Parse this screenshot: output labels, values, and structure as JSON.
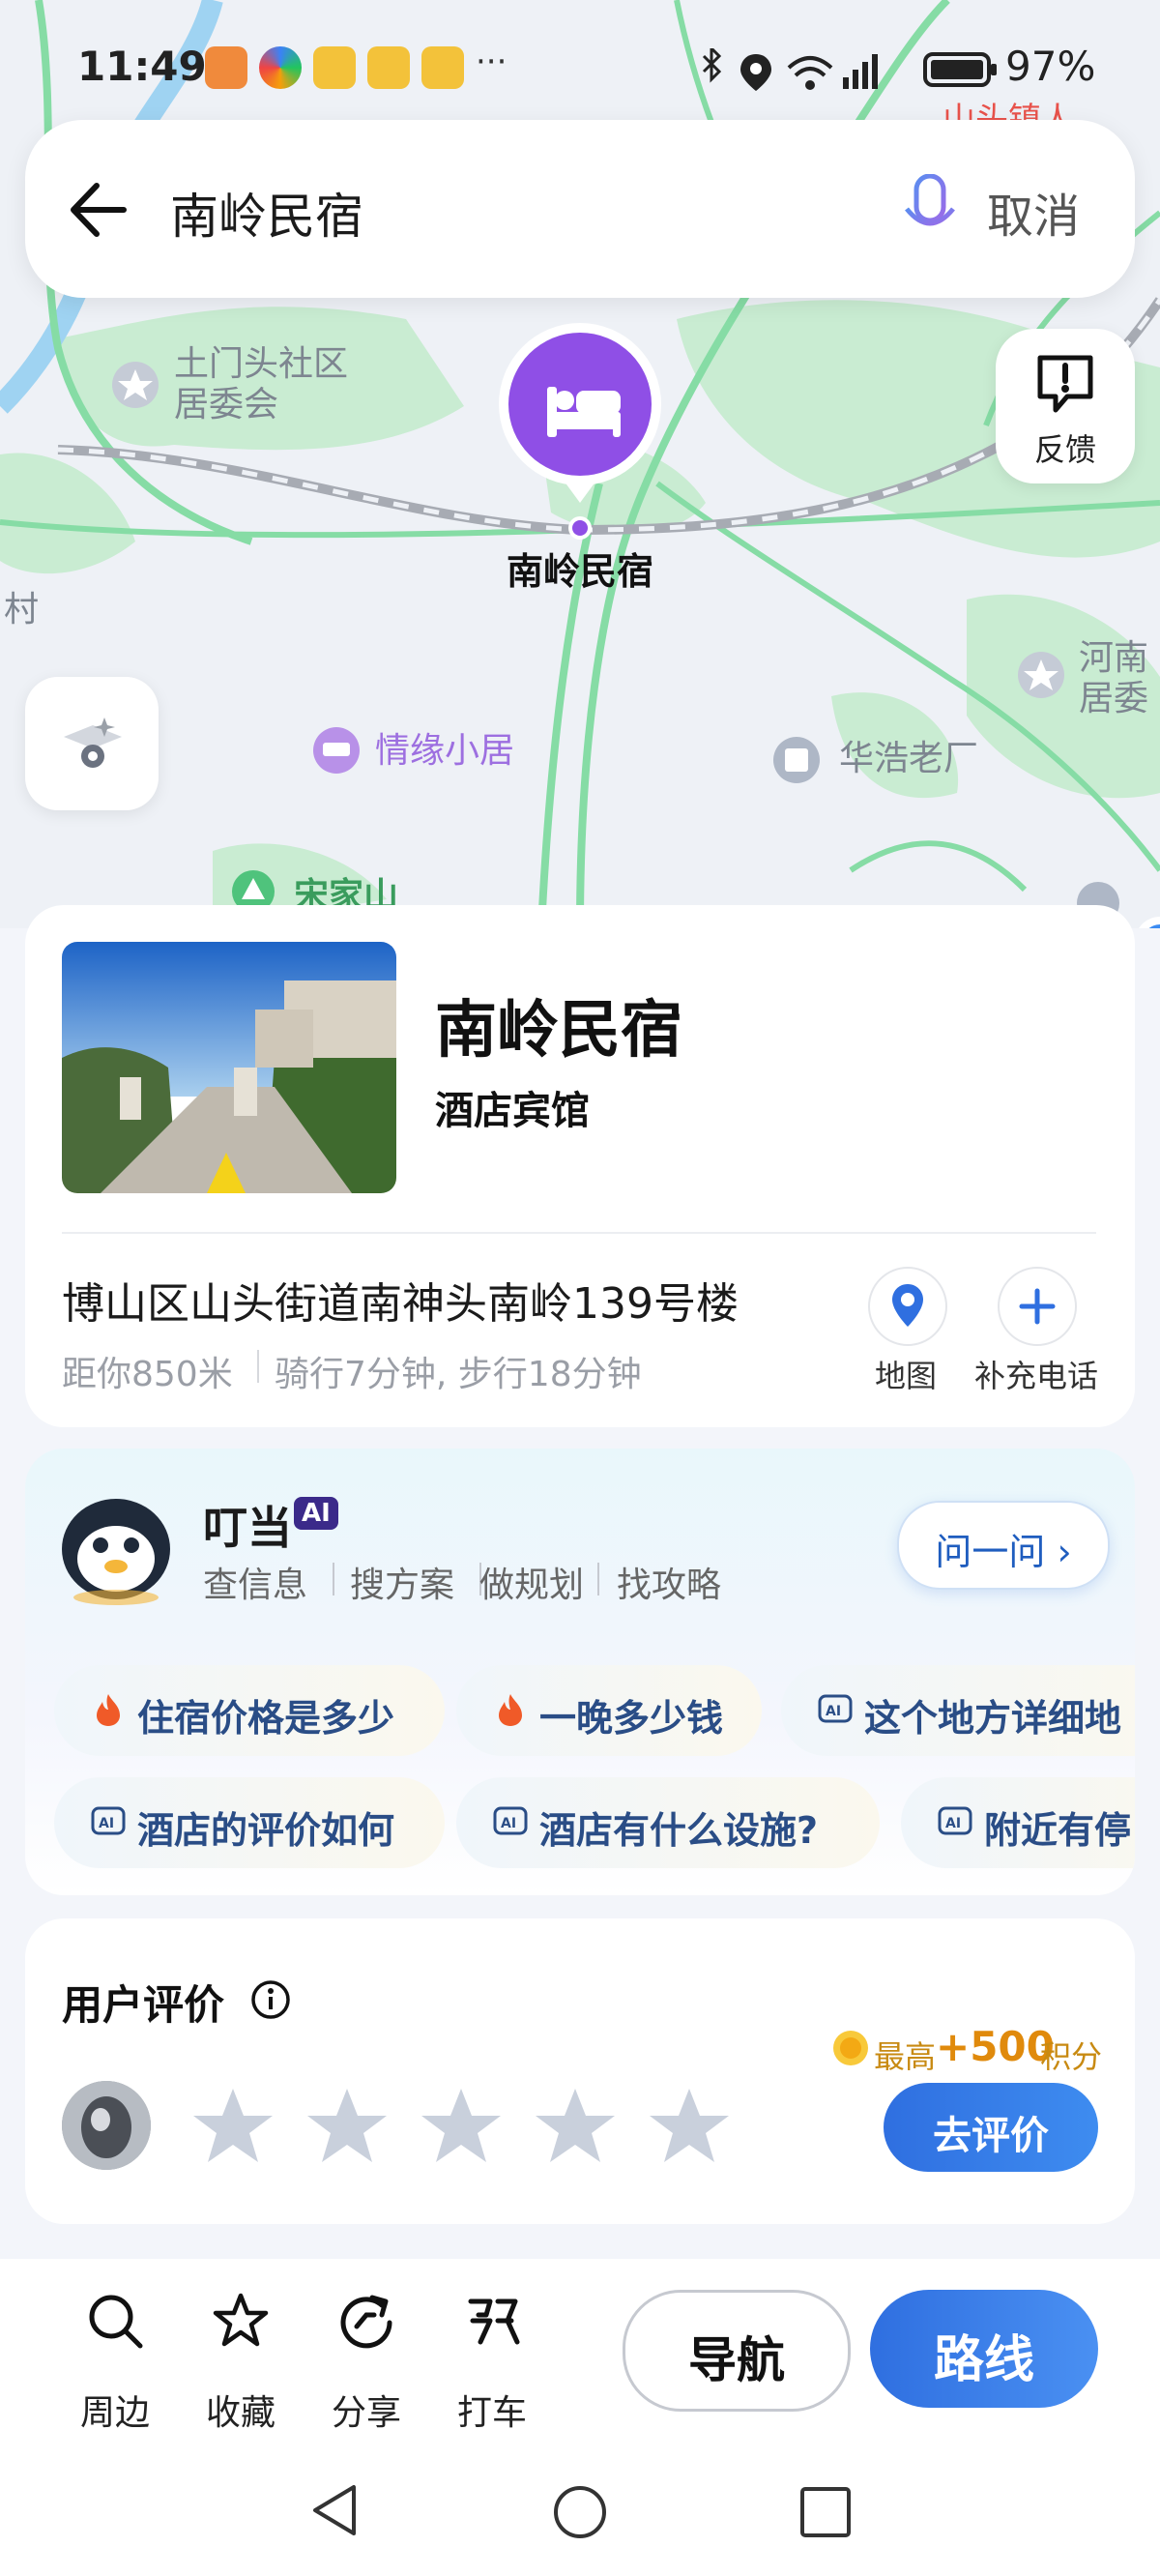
{
  "status_bar": {
    "time": "11:49",
    "more": "···",
    "battery": "97%",
    "region_badge": "山头镇人"
  },
  "search": {
    "query": "南岭民宿",
    "cancel_label": "取消"
  },
  "map": {
    "labels": {
      "community": "土门头社区\n居委会",
      "pin_label": "南岭民宿",
      "nearby_hotel": "情缘小居",
      "factory": "华浩老厂",
      "east_committee": "河南\n居委",
      "village": "村",
      "song_mountain": "宋家山"
    },
    "feedback_label": "反馈"
  },
  "place": {
    "name": "南岭民宿",
    "category": "酒店宾馆",
    "address": "博山区山头街道南神头南岭139号楼",
    "distance": "距你850米",
    "travel": "骑行7分钟, 步行18分钟",
    "map_label": "地图",
    "add_phone_label": "补充电话"
  },
  "assistant": {
    "name": "叮当",
    "badge": "AI",
    "features": [
      "查信息",
      "搜方案",
      "做规划",
      "找攻略"
    ],
    "ask_label": "问一问 ›",
    "chips_row1": [
      "住宿价格是多少",
      "一晚多少钱",
      "这个地方详细地"
    ],
    "chips_row2": [
      "酒店的评价如何",
      "酒店有什么设施?",
      "附近有停"
    ]
  },
  "reviews": {
    "title": "用户评价",
    "points_prefix": "最高",
    "points_value": "+500",
    "points_suffix": "积分",
    "rating": 0,
    "write_label": "去评价"
  },
  "bottom_nav": {
    "items": [
      "周边",
      "收藏",
      "分享",
      "打车"
    ],
    "navigate_label": "导航",
    "route_label": "路线"
  },
  "colors": {
    "accent": "#2f6fe0",
    "pin": "#8f4fe6",
    "road": "#86dca5",
    "park": "#c9ecd2"
  }
}
